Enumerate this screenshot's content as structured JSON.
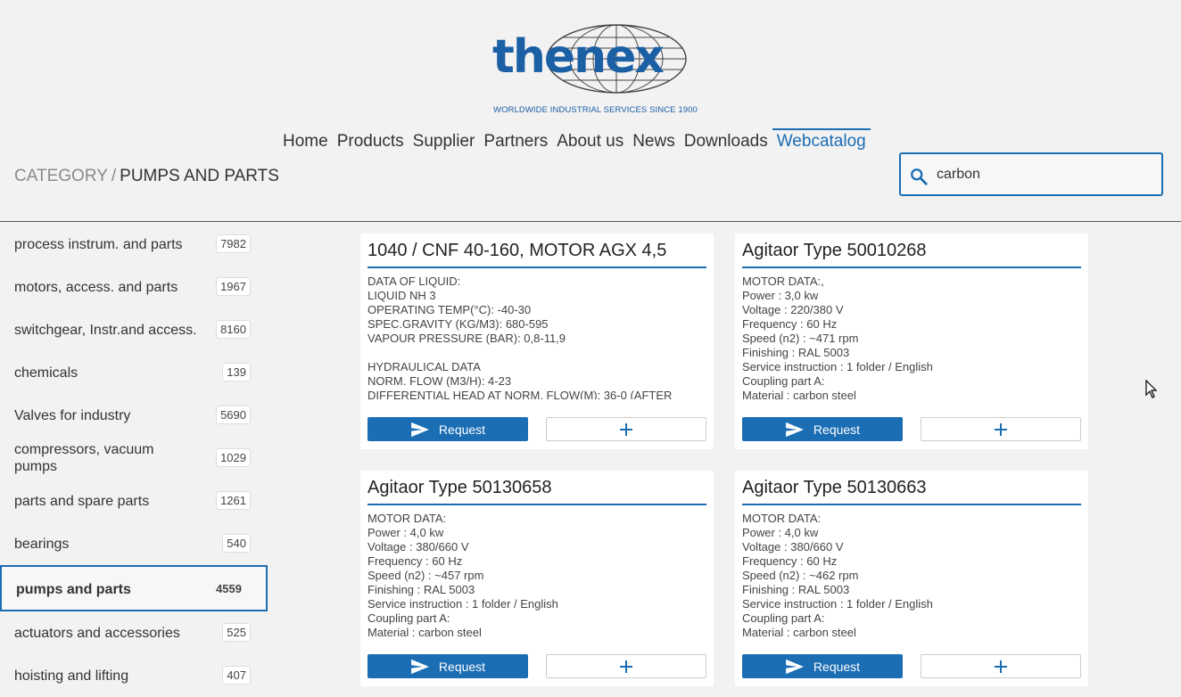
{
  "brand": {
    "logo_text": "thenex",
    "tagline": "WORLDWIDE INDUSTRIAL SERVICES SINCE 1900",
    "color": "#1b5fa5"
  },
  "nav": [
    {
      "label": "Home"
    },
    {
      "label": "Products"
    },
    {
      "label": "Supplier"
    },
    {
      "label": "Partners"
    },
    {
      "label": "About us"
    },
    {
      "label": "News"
    },
    {
      "label": "Downloads"
    },
    {
      "label": "Webcatalog",
      "active": true
    }
  ],
  "breadcrumb": {
    "root": "CATEGORY",
    "separator": "/",
    "current": "PUMPS AND PARTS"
  },
  "search": {
    "value": "carbon",
    "icon": "search-icon"
  },
  "categories": [
    {
      "label": "process instrum. and parts",
      "count": "7982"
    },
    {
      "label": "motors, access. and parts",
      "count": "1967"
    },
    {
      "label": "switchgear, Instr.and access.",
      "count": "8160"
    },
    {
      "label": "chemicals",
      "count": "139"
    },
    {
      "label": "Valves for industry",
      "count": "5690"
    },
    {
      "label": "compressors, vacuum pumps",
      "count": "1029"
    },
    {
      "label": "parts and spare parts",
      "count": "1261"
    },
    {
      "label": "bearings",
      "count": "540"
    },
    {
      "label": "pumps and parts",
      "count": "4559",
      "active": true
    },
    {
      "label": "actuators and accessories",
      "count": "525"
    },
    {
      "label": "hoisting and lifting",
      "count": "407"
    }
  ],
  "products": [
    {
      "title": "1040 / CNF 40-160, MOTOR AGX 4,5",
      "description": "DATA OF LIQUID:\nLIQUID NH 3\nOPERATING TEMP(°C): -40-30\nSPEC.GRAVITY (KG/M3): 680-595\nVAPOUR PRESSURE (BAR): 0,8-11,9\n\nHYDRAULICAL DATA\nNORM. FLOW (M3/H): 4-23\nDIFFERENTIAL HEAD AT NORM. FLOW(M): 36-0 (AFTER",
      "request_label": "Request"
    },
    {
      "title": "Agitaor Type 50010268",
      "description": "MOTOR DATA:,\nPower : 3,0 kw\nVoltage : 220/380 V\nFrequency : 60 Hz\nSpeed (n2) : ~471 rpm\nFinishing : RAL 5003\nService instruction : 1 folder / English\nCoupling part A:\nMaterial : carbon steel",
      "request_label": "Request"
    },
    {
      "title": "Agitaor Type 50130658",
      "description": "MOTOR DATA:\nPower : 4,0 kw\nVoltage : 380/660 V\nFrequency : 60 Hz\nSpeed (n2) : ~457 rpm\nFinishing : RAL 5003\nService instruction : 1 folder / English\nCoupling part A:\nMaterial : carbon steel",
      "request_label": "Request"
    },
    {
      "title": "Agitaor Type 50130663",
      "description": "MOTOR DATA:\nPower : 4,0 kw\nVoltage : 380/660 V\nFrequency : 60 Hz\nSpeed (n2) : ~462 rpm\nFinishing : RAL 5003\nService instruction : 1 folder / English\nCoupling part A:\nMaterial : carbon steel",
      "request_label": "Request"
    }
  ],
  "colors": {
    "accent": "#1b6db4",
    "background": "#f2f2f2",
    "card": "#ffffff"
  }
}
